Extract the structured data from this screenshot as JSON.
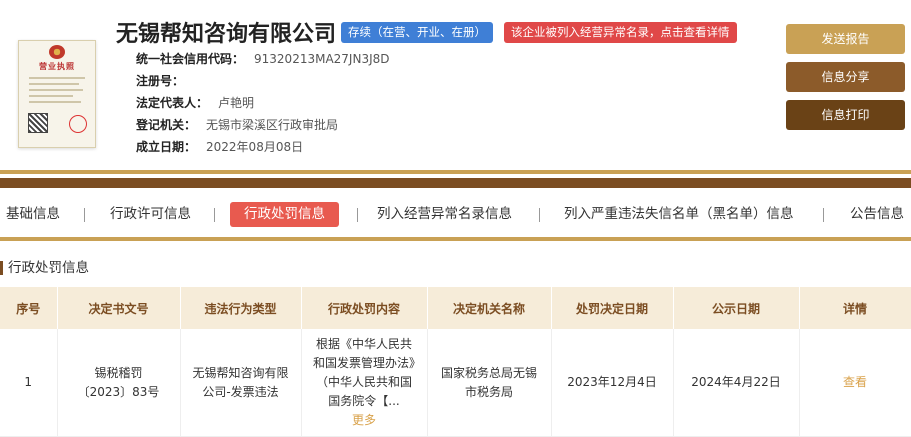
{
  "company": {
    "name": "无锡帮知咨询有限公司",
    "status_badge": "存续（在营、开业、在册）",
    "warning_badge": "该企业被列入经营异常名录，点击查看详情",
    "license_title": "营业执照",
    "fields": [
      {
        "key": "统一社会信用代码：",
        "value": "91320213MA27JN3J8D"
      },
      {
        "key": "注册号：",
        "value": ""
      },
      {
        "key": "法定代表人：",
        "value": "卢艳明"
      },
      {
        "key": "登记机关：",
        "value": "无锡市梁溪区行政审批局"
      },
      {
        "key": "成立日期：",
        "value": "2022年08月08日"
      }
    ]
  },
  "actions": {
    "report": "发送报告",
    "share": "信息分享",
    "print": "信息打印"
  },
  "tabs": [
    "基础信息",
    "行政许可信息",
    "行政处罚信息",
    "列入经营异常名录信息",
    "列入严重违法失信名单（黑名单）信息",
    "公告信息"
  ],
  "active_tab": "行政处罚信息",
  "section": {
    "title": "行政处罚信息"
  },
  "table": {
    "headers": [
      "序号",
      "决定书文号",
      "违法行为类型",
      "行政处罚内容",
      "决定机关名称",
      "处罚决定日期",
      "公示日期",
      "详情"
    ],
    "rows": [
      {
        "index": "1",
        "doc_no": "锡税稽罚〔2023〕83号",
        "violation": "无锡帮知咨询有限公司-发票违法",
        "content": "根据《中华人民共和国发票管理办法》（中华人民共和国国务院令【...",
        "more": "更多",
        "authority": "国家税务总局无锡市税务局",
        "decision_date": "2023年12月4日",
        "publish_date": "2024年4月22日",
        "detail": "查看"
      }
    ]
  },
  "colors": {
    "accent_gold": "#c9a155",
    "accent_brown": "#7b4d22",
    "active_tab": "#e85a4f",
    "status_blue": "#3f7fd6",
    "warning_red": "#e04848"
  }
}
